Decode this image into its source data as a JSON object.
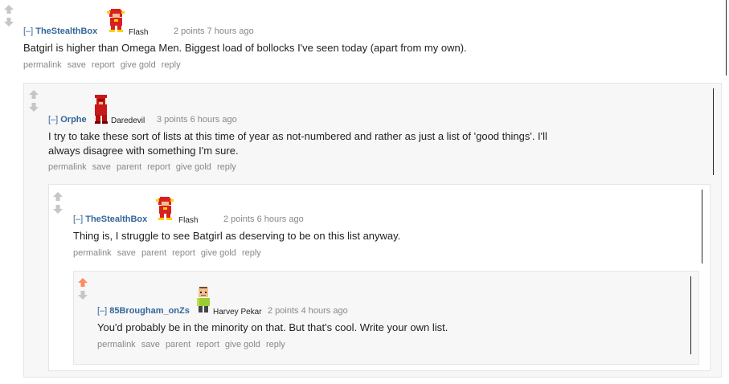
{
  "comments": [
    {
      "author": "TheStealthBox",
      "flair": "Flash",
      "flair_icon": "flash-icon",
      "score": "2 points",
      "time": "7 hours ago",
      "expand": "[–]",
      "body_lines": [
        "Batgirl is higher than Omega Men. Biggest load of bollocks I've seen today (apart from my own)."
      ],
      "buttons": [
        "permalink",
        "save",
        "report",
        "give gold",
        "reply"
      ],
      "vote": "neutral"
    },
    {
      "author": "Orphe",
      "flair": "Daredevil",
      "flair_icon": "daredevil-icon",
      "score": "3 points",
      "time": "6 hours ago",
      "expand": "[–]",
      "body_lines": [
        "I try to take these sort of lists at this time of year as not-numbered and rather as just a list of 'good things'. I'll",
        "always disagree with something I'm sure."
      ],
      "buttons": [
        "permalink",
        "save",
        "parent",
        "report",
        "give gold",
        "reply"
      ],
      "vote": "neutral"
    },
    {
      "author": "TheStealthBox",
      "flair": "Flash",
      "flair_icon": "flash-icon",
      "score": "2 points",
      "time": "6 hours ago",
      "expand": "[–]",
      "body_lines": [
        "Thing is, I struggle to see Batgirl as deserving to be on this list anyway."
      ],
      "buttons": [
        "permalink",
        "save",
        "parent",
        "report",
        "give gold",
        "reply"
      ],
      "vote": "neutral"
    },
    {
      "author": "85Brougham_onZs",
      "flair": "Harvey Pekar",
      "flair_icon": "harvey-pekar-icon",
      "score": "2 points",
      "time": "4 hours ago",
      "expand": "[–]",
      "body_lines": [
        "You'd probably be in the minority on that. But that's cool. Write your own list."
      ],
      "buttons": [
        "permalink",
        "save",
        "parent",
        "report",
        "give gold",
        "reply"
      ],
      "vote": "upvoted"
    }
  ],
  "colors": {
    "author": "#336699",
    "meta": "#888888",
    "upvote": "#ff8b60",
    "arrow_neutral": "#c6c6c6"
  }
}
